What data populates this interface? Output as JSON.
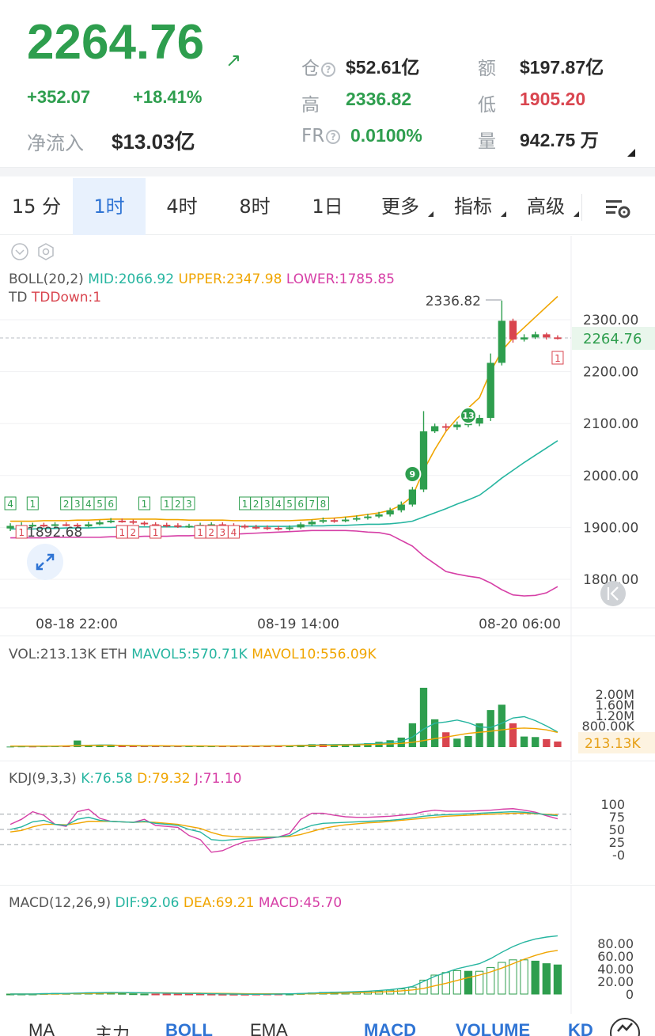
{
  "ticker": {
    "price": "2264.76",
    "change": "+352.07",
    "change_pct": "+18.41%",
    "netflow_label": "净流入",
    "netflow_value": "$13.03亿",
    "oi_label": "仓",
    "oi_value": "$52.61亿",
    "amount_label": "额",
    "amount_value": "$197.87亿",
    "high_label": "高",
    "high_value": "2336.82",
    "low_label": "低",
    "low_value": "1905.20",
    "fr_label": "FR",
    "fr_value": "0.0100%",
    "volume_label": "量",
    "volume_value": "942.75 万"
  },
  "timeframe_tabs": [
    {
      "label": "15 分"
    },
    {
      "label": "1时",
      "active": true
    },
    {
      "label": "4时"
    },
    {
      "label": "8时"
    },
    {
      "label": "1日"
    },
    {
      "label": "更多"
    },
    {
      "label": "指标"
    },
    {
      "label": "高级"
    }
  ],
  "main_chart": {
    "boll_label": "BOLL(20,2)",
    "mid": "MID:2066.92",
    "upper": "UPPER:2347.98",
    "lower": "LOWER:1785.85",
    "td_label": "TD",
    "td_value": "TDDown:1",
    "high_marker": "2336.82",
    "low_marker": "1892.68",
    "price_tag": "2264.76",
    "y_ticks": [
      "2300.00",
      "2200.00",
      "2100.00",
      "2000.00",
      "1900.00",
      "1800.00"
    ],
    "x_ticks": [
      "08-18 22:00",
      "08-19 14:00",
      "08-20 06:00"
    ]
  },
  "vol_panel": {
    "label": "VOL:213.13K ETH",
    "mavol5": "MAVOL5:570.71K",
    "mavol10": "MAVOL10:556.09K",
    "y_ticks": [
      "2.00M",
      "1.60M",
      "1.20M",
      "800.00K"
    ],
    "tag": "213.13K"
  },
  "kdj_panel": {
    "label": "KDJ(9,3,3)",
    "k": "K:76.58",
    "d": "D:79.32",
    "j": "J:71.10",
    "y_ticks": [
      "100",
      "75",
      "50",
      "25",
      "-0"
    ]
  },
  "macd_panel": {
    "label": "MACD(12,26,9)",
    "dif": "DIF:92.06",
    "dea": "DEA:69.21",
    "macd": "MACD:45.70",
    "y_ticks": [
      "80.00",
      "60.00",
      "40.00",
      "20.00",
      "0"
    ]
  },
  "bottom_tabs": [
    {
      "label": "MA"
    },
    {
      "label": "主力"
    },
    {
      "label": "BOLL",
      "active": true
    },
    {
      "label": "EMA"
    },
    {
      "label": "MACD",
      "active": true
    },
    {
      "label": "VOLUME",
      "active": true
    },
    {
      "label": "KD",
      "active": true
    }
  ],
  "colors": {
    "up": "#2e9e4e",
    "down": "#d9454f",
    "mid": "#26b5a0",
    "upper": "#f0a500",
    "lower": "#d63fa6",
    "accent": "#2f74d4"
  },
  "chart_data": {
    "type": "candlestick",
    "y_range": [
      1760,
      2350
    ],
    "candles": [
      [
        1898,
        1903,
        1908,
        1893
      ],
      [
        1903,
        1904,
        1910,
        1898
      ],
      [
        1904,
        1905,
        1909,
        1900
      ],
      [
        1905,
        1904,
        1909,
        1900
      ],
      [
        1904,
        1906,
        1910,
        1901
      ],
      [
        1906,
        1905,
        1910,
        1902
      ],
      [
        1905,
        1902,
        1908,
        1899
      ],
      [
        1902,
        1906,
        1911,
        1900
      ],
      [
        1906,
        1910,
        1914,
        1904
      ],
      [
        1910,
        1913,
        1918,
        1908
      ],
      [
        1913,
        1912,
        1917,
        1909
      ],
      [
        1912,
        1909,
        1915,
        1906
      ],
      [
        1909,
        1906,
        1912,
        1903
      ],
      [
        1906,
        1905,
        1910,
        1902
      ],
      [
        1905,
        1904,
        1909,
        1900
      ],
      [
        1904,
        1902,
        1908,
        1899
      ],
      [
        1902,
        1903,
        1907,
        1899
      ],
      [
        1903,
        1905,
        1909,
        1901
      ],
      [
        1905,
        1906,
        1910,
        1902
      ],
      [
        1906,
        1904,
        1910,
        1901
      ],
      [
        1904,
        1903,
        1908,
        1900
      ],
      [
        1903,
        1901,
        1906,
        1897
      ],
      [
        1901,
        1900,
        1905,
        1896
      ],
      [
        1900,
        1899,
        1904,
        1895
      ],
      [
        1899,
        1898,
        1903,
        1894
      ],
      [
        1898,
        1900,
        1904,
        1894
      ],
      [
        1900,
        1906,
        1910,
        1897
      ],
      [
        1906,
        1911,
        1915,
        1903
      ],
      [
        1911,
        1914,
        1919,
        1908
      ],
      [
        1914,
        1912,
        1918,
        1909
      ],
      [
        1912,
        1915,
        1920,
        1910
      ],
      [
        1915,
        1918,
        1923,
        1912
      ],
      [
        1918,
        1921,
        1926,
        1915
      ],
      [
        1921,
        1925,
        1930,
        1918
      ],
      [
        1925,
        1933,
        1938,
        1921
      ],
      [
        1933,
        1944,
        1950,
        1929
      ],
      [
        1944,
        1973,
        1978,
        1940
      ],
      [
        1973,
        2085,
        2124,
        1968
      ],
      [
        2085,
        2095,
        2100,
        2082
      ],
      [
        2095,
        2093,
        2100,
        2086
      ],
      [
        2093,
        2098,
        2104,
        2088
      ],
      [
        2098,
        2100,
        2106,
        2093
      ],
      [
        2100,
        2111,
        2117,
        2095
      ],
      [
        2111,
        2217,
        2235,
        2105
      ],
      [
        2217,
        2298,
        2337,
        2212
      ],
      [
        2298,
        2262,
        2302,
        2256
      ],
      [
        2262,
        2266,
        2272,
        2258
      ],
      [
        2266,
        2272,
        2277,
        2263
      ],
      [
        2272,
        2266,
        2275,
        2262
      ],
      [
        2266,
        2265,
        2270,
        2262
      ]
    ],
    "upper": [
      1912,
      1912,
      1912,
      1913,
      1913,
      1913,
      1914,
      1914,
      1915,
      1916,
      1916,
      1916,
      1916,
      1916,
      1915,
      1915,
      1914,
      1914,
      1914,
      1914,
      1913,
      1913,
      1913,
      1913,
      1913,
      1913,
      1914,
      1915,
      1917,
      1918,
      1920,
      1922,
      1925,
      1928,
      1933,
      1943,
      1960,
      2010,
      2050,
      2085,
      2110,
      2130,
      2150,
      2200,
      2240,
      2265,
      2285,
      2305,
      2325,
      2345
    ],
    "mid": [
      1897,
      1897,
      1897,
      1898,
      1898,
      1899,
      1899,
      1899,
      1900,
      1900,
      1901,
      1901,
      1901,
      1901,
      1901,
      1901,
      1901,
      1901,
      1901,
      1901,
      1902,
      1902,
      1902,
      1902,
      1902,
      1902,
      1903,
      1903,
      1903,
      1904,
      1904,
      1905,
      1906,
      1906,
      1907,
      1909,
      1912,
      1920,
      1928,
      1936,
      1945,
      1953,
      1962,
      1978,
      1995,
      2010,
      2025,
      2039,
      2053,
      2067
    ],
    "lower": [
      1880,
      1880,
      1880,
      1880,
      1881,
      1881,
      1881,
      1881,
      1881,
      1882,
      1882,
      1882,
      1883,
      1883,
      1883,
      1884,
      1884,
      1885,
      1885,
      1886,
      1887,
      1888,
      1889,
      1890,
      1891,
      1892,
      1893,
      1894,
      1894,
      1894,
      1894,
      1893,
      1891,
      1890,
      1886,
      1875,
      1864,
      1845,
      1830,
      1815,
      1810,
      1806,
      1803,
      1793,
      1780,
      1770,
      1768,
      1769,
      1774,
      1786
    ],
    "td_up": [
      [
        0,
        "4"
      ],
      [
        2,
        "1"
      ],
      [
        5,
        "2"
      ],
      [
        6,
        "3"
      ],
      [
        7,
        "4"
      ],
      [
        8,
        "5"
      ],
      [
        9,
        "6"
      ],
      [
        12,
        "1"
      ],
      [
        14,
        "1"
      ],
      [
        15,
        "2"
      ],
      [
        16,
        "3"
      ],
      [
        21,
        "1"
      ],
      [
        22,
        "2"
      ],
      [
        23,
        "3"
      ],
      [
        24,
        "4"
      ],
      [
        25,
        "5"
      ],
      [
        26,
        "6"
      ],
      [
        27,
        "7"
      ],
      [
        28,
        "8"
      ]
    ],
    "td_down": [
      [
        1,
        "1"
      ],
      [
        10,
        "1"
      ],
      [
        11,
        "2"
      ],
      [
        13,
        "1"
      ],
      [
        17,
        "1"
      ],
      [
        18,
        "2"
      ],
      [
        19,
        "3"
      ],
      [
        20,
        "4"
      ],
      [
        49,
        "1"
      ]
    ],
    "stars": [
      [
        36,
        "9"
      ],
      [
        41,
        "13"
      ]
    ],
    "volume": [
      20,
      25,
      22,
      28,
      30,
      35,
      250,
      80,
      70,
      60,
      50,
      45,
      40,
      38,
      36,
      35,
      40,
      42,
      45,
      38,
      36,
      40,
      45,
      50,
      60,
      70,
      90,
      110,
      120,
      100,
      90,
      95,
      150,
      200,
      260,
      360,
      900,
      2240,
      1050,
      560,
      320,
      420,
      900,
      1400,
      1600,
      900,
      400,
      380,
      300,
      213
    ],
    "volume_up": [
      true,
      true,
      false,
      true,
      true,
      false,
      true,
      true,
      true,
      true,
      false,
      false,
      false,
      false,
      false,
      false,
      true,
      true,
      true,
      false,
      false,
      false,
      false,
      false,
      false,
      true,
      true,
      true,
      false,
      true,
      true,
      true,
      true,
      true,
      true,
      true,
      true,
      true,
      true,
      false,
      true,
      true,
      true,
      true,
      true,
      false,
      true,
      true,
      false,
      false
    ],
    "mavol5": [
      30,
      30,
      30,
      30,
      30,
      40,
      60,
      70,
      80,
      80,
      60,
      50,
      45,
      42,
      40,
      40,
      40,
      40,
      40,
      40,
      40,
      40,
      42,
      45,
      50,
      55,
      65,
      75,
      85,
      95,
      100,
      105,
      120,
      140,
      170,
      220,
      380,
      680,
      900,
      950,
      1020,
      920,
      760,
      740,
      900,
      1100,
      1150,
      1000,
      800,
      571
    ],
    "mavol10": [
      40,
      40,
      40,
      40,
      40,
      45,
      55,
      60,
      65,
      68,
      65,
      60,
      55,
      52,
      50,
      48,
      46,
      45,
      44,
      43,
      42,
      42,
      43,
      44,
      46,
      50,
      55,
      60,
      65,
      72,
      80,
      88,
      95,
      105,
      120,
      140,
      180,
      250,
      320,
      380,
      450,
      520,
      560,
      600,
      650,
      700,
      720,
      700,
      650,
      556
    ],
    "kdj_k": [
      50,
      55,
      65,
      68,
      60,
      58,
      70,
      74,
      68,
      66,
      65,
      64,
      66,
      62,
      60,
      58,
      50,
      45,
      30,
      28,
      30,
      32,
      33,
      34,
      35,
      38,
      50,
      58,
      62,
      63,
      64,
      65,
      66,
      67,
      68,
      70,
      73,
      76,
      78,
      79,
      80,
      81,
      82,
      83,
      84,
      85,
      84,
      82,
      79,
      77
    ],
    "kdj_d": [
      45,
      48,
      55,
      60,
      60,
      59,
      62,
      66,
      66,
      66,
      65,
      64,
      65,
      64,
      62,
      60,
      56,
      52,
      44,
      38,
      36,
      35,
      35,
      35,
      35,
      36,
      40,
      46,
      52,
      56,
      59,
      61,
      63,
      64,
      66,
      68,
      70,
      72,
      74,
      76,
      77,
      78,
      79,
      80,
      81,
      82,
      82,
      81,
      80,
      79
    ],
    "kdj_j": [
      60,
      70,
      85,
      78,
      60,
      56,
      85,
      90,
      72,
      66,
      65,
      64,
      70,
      58,
      56,
      54,
      38,
      30,
      5,
      8,
      18,
      26,
      29,
      32,
      35,
      42,
      70,
      82,
      82,
      78,
      75,
      74,
      74,
      75,
      76,
      78,
      80,
      85,
      88,
      86,
      86,
      86,
      87,
      88,
      90,
      91,
      88,
      84,
      77,
      71
    ],
    "macd_dif": [
      0,
      0,
      0,
      0.5,
      0.8,
      1,
      1.5,
      2,
      2.3,
      2.5,
      2.4,
      2.2,
      2,
      1.8,
      1.5,
      1.2,
      1,
      0.8,
      0.5,
      0.2,
      0,
      -0.2,
      -0.3,
      -0.2,
      0,
      0.3,
      0.8,
      1.5,
      2.2,
      2.8,
      3.2,
      3.8,
      4.5,
      5.5,
      7,
      9,
      12,
      20,
      28,
      34,
      40,
      44,
      48,
      56,
      66,
      75,
      82,
      87,
      90,
      92
    ],
    "macd_dea": [
      0,
      0,
      0,
      0.1,
      0.3,
      0.5,
      0.8,
      1,
      1.4,
      1.7,
      1.9,
      2,
      2,
      2,
      1.9,
      1.7,
      1.5,
      1.4,
      1.2,
      1,
      0.8,
      0.6,
      0.4,
      0.3,
      0.3,
      0.3,
      0.4,
      0.6,
      0.9,
      1.3,
      1.7,
      2.1,
      2.6,
      3.2,
      4,
      5,
      6.5,
      9,
      13,
      17,
      21.5,
      26,
      30,
      35,
      41,
      48,
      55,
      61,
      66,
      69
    ],
    "macd_hist": [
      0,
      0,
      0,
      0.4,
      0.5,
      0.5,
      0.7,
      1,
      0.9,
      0.8,
      0.5,
      0.2,
      0,
      -0.2,
      -0.4,
      -0.5,
      -0.5,
      -0.6,
      -0.7,
      -0.8,
      -0.8,
      -0.8,
      -0.7,
      -0.5,
      -0.3,
      0,
      0.4,
      0.9,
      1.3,
      1.5,
      1.5,
      1.7,
      1.9,
      2.3,
      3,
      4,
      5.5,
      11,
      15,
      17,
      18.5,
      18,
      18,
      21,
      25,
      27,
      27,
      26,
      24,
      23
    ]
  }
}
